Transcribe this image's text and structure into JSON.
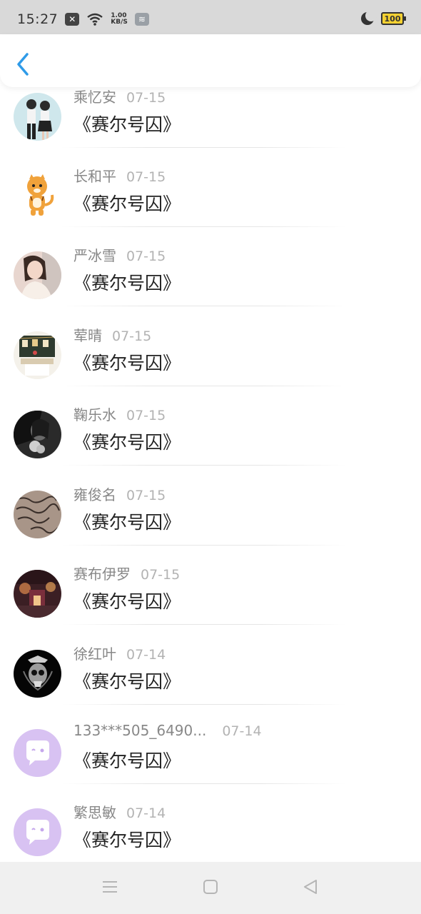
{
  "status_bar": {
    "time": "15:27",
    "net_speed_value": "1.00",
    "net_speed_unit": "KB/S",
    "battery": "100"
  },
  "conversations": [
    {
      "name": "乘忆安",
      "date": "07-15",
      "message": "《赛尔号囚》"
    },
    {
      "name": "长和平",
      "date": "07-15",
      "message": "《赛尔号囚》"
    },
    {
      "name": "严冰雪",
      "date": "07-15",
      "message": "《赛尔号囚》"
    },
    {
      "name": "荤晴",
      "date": "07-15",
      "message": "《赛尔号囚》"
    },
    {
      "name": "鞠乐水",
      "date": "07-15",
      "message": "《赛尔号囚》"
    },
    {
      "name": "雍俊名",
      "date": "07-15",
      "message": "《赛尔号囚》"
    },
    {
      "name": "赛布伊罗",
      "date": "07-15",
      "message": "《赛尔号囚》"
    },
    {
      "name": "徐红叶",
      "date": "07-14",
      "message": "《赛尔号囚》"
    },
    {
      "name": "133***505_6490...",
      "date": "07-14",
      "message": "《赛尔号囚》"
    },
    {
      "name": "繁思敏",
      "date": "07-14",
      "message": "《赛尔号囚》"
    }
  ],
  "colors": {
    "accent": "#2f9be8",
    "default_avatar": "#d8c2f2"
  }
}
